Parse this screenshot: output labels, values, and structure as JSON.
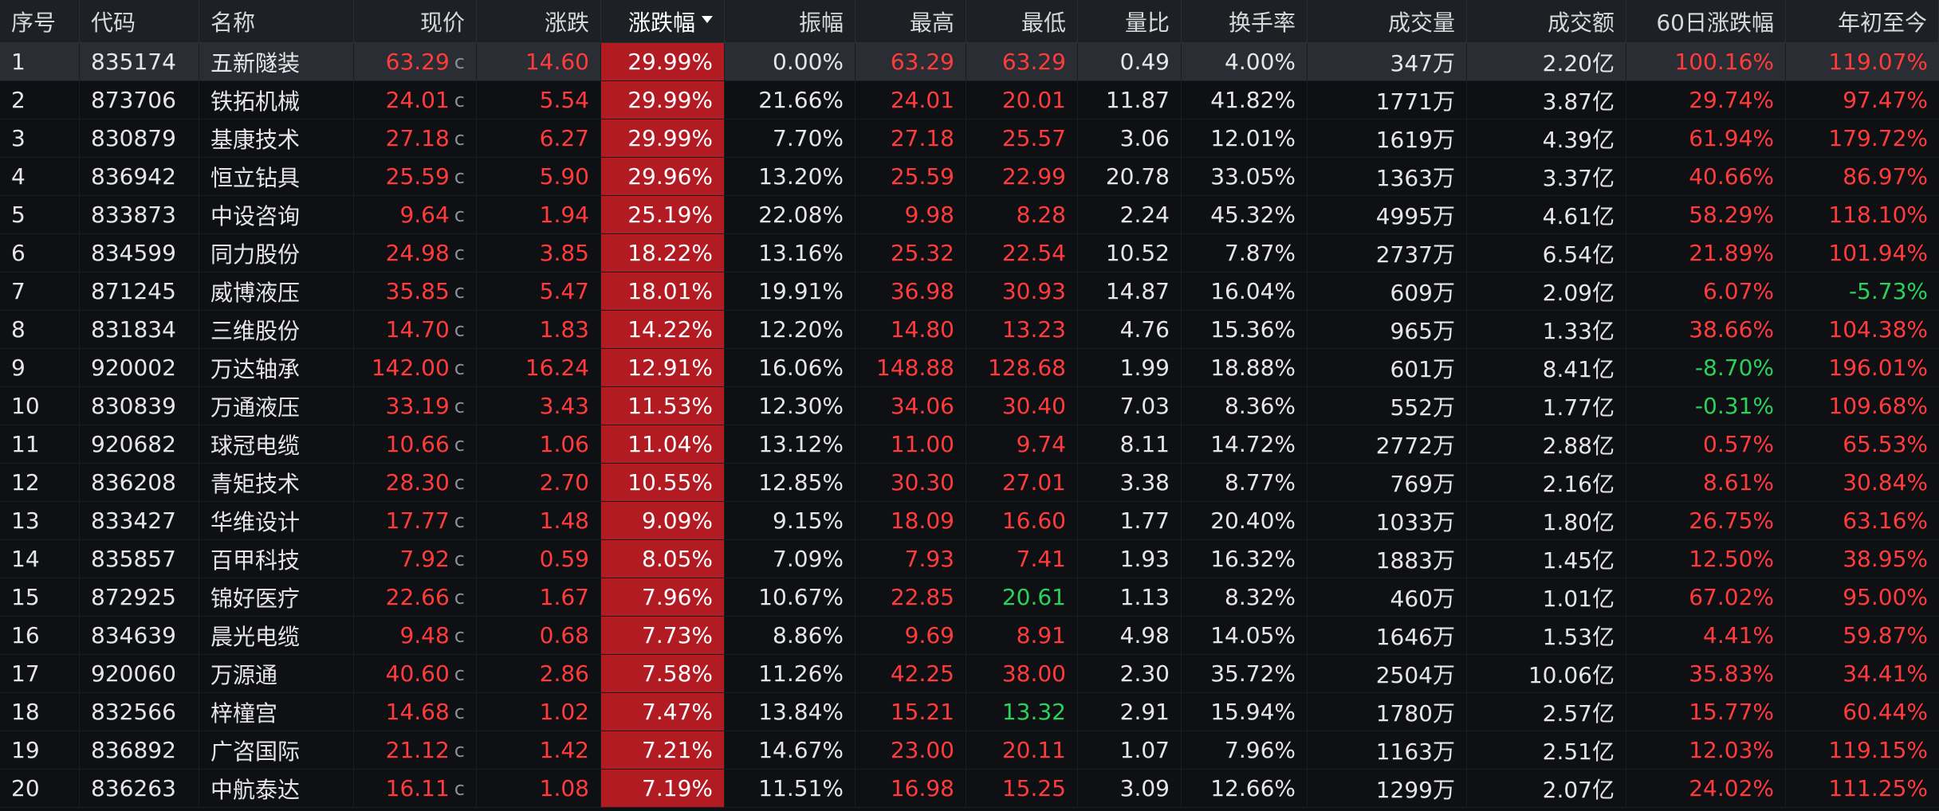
{
  "columns": {
    "seq": "序号",
    "code": "代码",
    "name": "名称",
    "price": "现价",
    "change": "涨跌",
    "pct": "涨跌幅",
    "amplitude": "振幅",
    "high": "最高",
    "low": "最低",
    "volume_ratio": "量比",
    "turnover": "换手率",
    "volume": "成交量",
    "amount": "成交额",
    "change_60d": "60日涨跌幅",
    "ytd": "年初至今"
  },
  "price_suffix": "c",
  "colors": {
    "red": "#ff3b3b",
    "green": "#2ad25a",
    "highlight": "#b31b23",
    "header_bg": "#1d2025",
    "row_bg": "#0e1014"
  },
  "sort": {
    "column": "涨跌幅",
    "direction": "desc",
    "icon": "sort-desc-icon"
  },
  "rows": [
    {
      "seq": "1",
      "code": "835174",
      "name": "五新隧装",
      "price": "63.29",
      "change": "14.60",
      "pct": "29.99%",
      "amplitude": "0.00%",
      "high": "63.29",
      "low": "63.29",
      "volume_ratio": "0.49",
      "turnover": "4.00%",
      "volume": "347万",
      "amount": "2.20亿",
      "change_60d": "100.16%",
      "ytd": "119.07%",
      "high_color": "red",
      "low_color": "red",
      "d60_color": "red",
      "ytd_color": "red",
      "selected": true
    },
    {
      "seq": "2",
      "code": "873706",
      "name": "铁拓机械",
      "price": "24.01",
      "change": "5.54",
      "pct": "29.99%",
      "amplitude": "21.66%",
      "high": "24.01",
      "low": "20.01",
      "volume_ratio": "11.87",
      "turnover": "41.82%",
      "volume": "1771万",
      "amount": "3.87亿",
      "change_60d": "29.74%",
      "ytd": "97.47%",
      "high_color": "red",
      "low_color": "red",
      "d60_color": "red",
      "ytd_color": "red"
    },
    {
      "seq": "3",
      "code": "830879",
      "name": "基康技术",
      "price": "27.18",
      "change": "6.27",
      "pct": "29.99%",
      "amplitude": "7.70%",
      "high": "27.18",
      "low": "25.57",
      "volume_ratio": "3.06",
      "turnover": "12.01%",
      "volume": "1619万",
      "amount": "4.39亿",
      "change_60d": "61.94%",
      "ytd": "179.72%",
      "high_color": "red",
      "low_color": "red",
      "d60_color": "red",
      "ytd_color": "red"
    },
    {
      "seq": "4",
      "code": "836942",
      "name": "恒立钻具",
      "price": "25.59",
      "change": "5.90",
      "pct": "29.96%",
      "amplitude": "13.20%",
      "high": "25.59",
      "low": "22.99",
      "volume_ratio": "20.78",
      "turnover": "33.05%",
      "volume": "1363万",
      "amount": "3.37亿",
      "change_60d": "40.66%",
      "ytd": "86.97%",
      "high_color": "red",
      "low_color": "red",
      "d60_color": "red",
      "ytd_color": "red"
    },
    {
      "seq": "5",
      "code": "833873",
      "name": "中设咨询",
      "price": "9.64",
      "change": "1.94",
      "pct": "25.19%",
      "amplitude": "22.08%",
      "high": "9.98",
      "low": "8.28",
      "volume_ratio": "2.24",
      "turnover": "45.32%",
      "volume": "4995万",
      "amount": "4.61亿",
      "change_60d": "58.29%",
      "ytd": "118.10%",
      "high_color": "red",
      "low_color": "red",
      "d60_color": "red",
      "ytd_color": "red"
    },
    {
      "seq": "6",
      "code": "834599",
      "name": "同力股份",
      "price": "24.98",
      "change": "3.85",
      "pct": "18.22%",
      "amplitude": "13.16%",
      "high": "25.32",
      "low": "22.54",
      "volume_ratio": "10.52",
      "turnover": "7.87%",
      "volume": "2737万",
      "amount": "6.54亿",
      "change_60d": "21.89%",
      "ytd": "101.94%",
      "high_color": "red",
      "low_color": "red",
      "d60_color": "red",
      "ytd_color": "red"
    },
    {
      "seq": "7",
      "code": "871245",
      "name": "威博液压",
      "price": "35.85",
      "change": "5.47",
      "pct": "18.01%",
      "amplitude": "19.91%",
      "high": "36.98",
      "low": "30.93",
      "volume_ratio": "14.87",
      "turnover": "16.04%",
      "volume": "609万",
      "amount": "2.09亿",
      "change_60d": "6.07%",
      "ytd": "-5.73%",
      "high_color": "red",
      "low_color": "red",
      "d60_color": "red",
      "ytd_color": "green"
    },
    {
      "seq": "8",
      "code": "831834",
      "name": "三维股份",
      "price": "14.70",
      "change": "1.83",
      "pct": "14.22%",
      "amplitude": "12.20%",
      "high": "14.80",
      "low": "13.23",
      "volume_ratio": "4.76",
      "turnover": "15.36%",
      "volume": "965万",
      "amount": "1.33亿",
      "change_60d": "38.66%",
      "ytd": "104.38%",
      "high_color": "red",
      "low_color": "red",
      "d60_color": "red",
      "ytd_color": "red"
    },
    {
      "seq": "9",
      "code": "920002",
      "name": "万达轴承",
      "price": "142.00",
      "change": "16.24",
      "pct": "12.91%",
      "amplitude": "16.06%",
      "high": "148.88",
      "low": "128.68",
      "volume_ratio": "1.99",
      "turnover": "18.88%",
      "volume": "601万",
      "amount": "8.41亿",
      "change_60d": "-8.70%",
      "ytd": "196.01%",
      "high_color": "red",
      "low_color": "red",
      "d60_color": "green",
      "ytd_color": "red"
    },
    {
      "seq": "10",
      "code": "830839",
      "name": "万通液压",
      "price": "33.19",
      "change": "3.43",
      "pct": "11.53%",
      "amplitude": "12.30%",
      "high": "34.06",
      "low": "30.40",
      "volume_ratio": "7.03",
      "turnover": "8.36%",
      "volume": "552万",
      "amount": "1.77亿",
      "change_60d": "-0.31%",
      "ytd": "109.68%",
      "high_color": "red",
      "low_color": "red",
      "d60_color": "green",
      "ytd_color": "red"
    },
    {
      "seq": "11",
      "code": "920682",
      "name": "球冠电缆",
      "price": "10.66",
      "change": "1.06",
      "pct": "11.04%",
      "amplitude": "13.12%",
      "high": "11.00",
      "low": "9.74",
      "volume_ratio": "8.11",
      "turnover": "14.72%",
      "volume": "2772万",
      "amount": "2.88亿",
      "change_60d": "0.57%",
      "ytd": "65.53%",
      "high_color": "red",
      "low_color": "red",
      "d60_color": "red",
      "ytd_color": "red"
    },
    {
      "seq": "12",
      "code": "836208",
      "name": "青矩技术",
      "price": "28.30",
      "change": "2.70",
      "pct": "10.55%",
      "amplitude": "12.85%",
      "high": "30.30",
      "low": "27.01",
      "volume_ratio": "3.38",
      "turnover": "8.77%",
      "volume": "769万",
      "amount": "2.16亿",
      "change_60d": "8.61%",
      "ytd": "30.84%",
      "high_color": "red",
      "low_color": "red",
      "d60_color": "red",
      "ytd_color": "red"
    },
    {
      "seq": "13",
      "code": "833427",
      "name": "华维设计",
      "price": "17.77",
      "change": "1.48",
      "pct": "9.09%",
      "amplitude": "9.15%",
      "high": "18.09",
      "low": "16.60",
      "volume_ratio": "1.77",
      "turnover": "20.40%",
      "volume": "1033万",
      "amount": "1.80亿",
      "change_60d": "26.75%",
      "ytd": "63.16%",
      "high_color": "red",
      "low_color": "red",
      "d60_color": "red",
      "ytd_color": "red"
    },
    {
      "seq": "14",
      "code": "835857",
      "name": "百甲科技",
      "price": "7.92",
      "change": "0.59",
      "pct": "8.05%",
      "amplitude": "7.09%",
      "high": "7.93",
      "low": "7.41",
      "volume_ratio": "1.93",
      "turnover": "16.32%",
      "volume": "1883万",
      "amount": "1.45亿",
      "change_60d": "12.50%",
      "ytd": "38.95%",
      "high_color": "red",
      "low_color": "red",
      "d60_color": "red",
      "ytd_color": "red"
    },
    {
      "seq": "15",
      "code": "872925",
      "name": "锦好医疗",
      "price": "22.66",
      "change": "1.67",
      "pct": "7.96%",
      "amplitude": "10.67%",
      "high": "22.85",
      "low": "20.61",
      "volume_ratio": "1.13",
      "turnover": "8.32%",
      "volume": "460万",
      "amount": "1.01亿",
      "change_60d": "67.02%",
      "ytd": "95.00%",
      "high_color": "red",
      "low_color": "green",
      "d60_color": "red",
      "ytd_color": "red"
    },
    {
      "seq": "16",
      "code": "834639",
      "name": "晨光电缆",
      "price": "9.48",
      "change": "0.68",
      "pct": "7.73%",
      "amplitude": "8.86%",
      "high": "9.69",
      "low": "8.91",
      "volume_ratio": "4.98",
      "turnover": "14.05%",
      "volume": "1646万",
      "amount": "1.53亿",
      "change_60d": "4.41%",
      "ytd": "59.87%",
      "high_color": "red",
      "low_color": "red",
      "d60_color": "red",
      "ytd_color": "red"
    },
    {
      "seq": "17",
      "code": "920060",
      "name": "万源通",
      "price": "40.60",
      "change": "2.86",
      "pct": "7.58%",
      "amplitude": "11.26%",
      "high": "42.25",
      "low": "38.00",
      "volume_ratio": "2.30",
      "turnover": "35.72%",
      "volume": "2504万",
      "amount": "10.06亿",
      "change_60d": "35.83%",
      "ytd": "34.41%",
      "high_color": "red",
      "low_color": "red",
      "d60_color": "red",
      "ytd_color": "red"
    },
    {
      "seq": "18",
      "code": "832566",
      "name": "梓橦宫",
      "price": "14.68",
      "change": "1.02",
      "pct": "7.47%",
      "amplitude": "13.84%",
      "high": "15.21",
      "low": "13.32",
      "volume_ratio": "2.91",
      "turnover": "15.94%",
      "volume": "1780万",
      "amount": "2.57亿",
      "change_60d": "15.77%",
      "ytd": "60.44%",
      "high_color": "red",
      "low_color": "green",
      "d60_color": "red",
      "ytd_color": "red"
    },
    {
      "seq": "19",
      "code": "836892",
      "name": "广咨国际",
      "price": "21.12",
      "change": "1.42",
      "pct": "7.21%",
      "amplitude": "14.67%",
      "high": "23.00",
      "low": "20.11",
      "volume_ratio": "1.07",
      "turnover": "7.96%",
      "volume": "1163万",
      "amount": "2.51亿",
      "change_60d": "12.03%",
      "ytd": "119.15%",
      "high_color": "red",
      "low_color": "red",
      "d60_color": "red",
      "ytd_color": "red"
    },
    {
      "seq": "20",
      "code": "836263",
      "name": "中航泰达",
      "price": "16.11",
      "change": "1.08",
      "pct": "7.19%",
      "amplitude": "11.51%",
      "high": "16.98",
      "low": "15.25",
      "volume_ratio": "3.09",
      "turnover": "12.66%",
      "volume": "1299万",
      "amount": "2.07亿",
      "change_60d": "24.02%",
      "ytd": "111.25%",
      "high_color": "red",
      "low_color": "red",
      "d60_color": "red",
      "ytd_color": "red"
    }
  ]
}
